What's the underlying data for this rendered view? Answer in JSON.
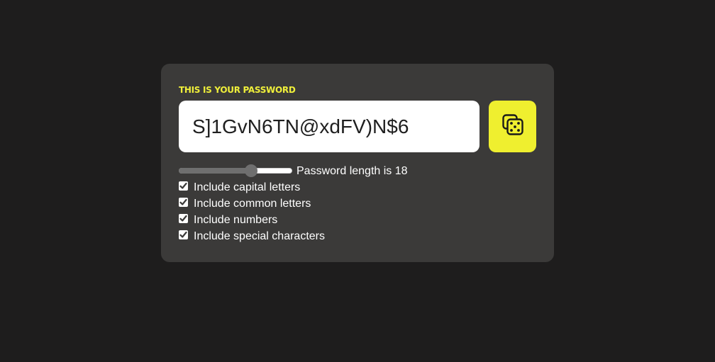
{
  "header": {
    "title": "THIS IS YOUR PASSWORD"
  },
  "password": {
    "value": "S]1GvN6TN@xdFV)N$6"
  },
  "generate_button": {
    "icon": "dice-icon",
    "color": "#efef2f"
  },
  "length": {
    "label": "Password length is 18",
    "value": 18,
    "fraction": 0.64
  },
  "options": [
    {
      "label": "Include capital letters",
      "checked": true
    },
    {
      "label": "Include common letters",
      "checked": true
    },
    {
      "label": "Include numbers",
      "checked": true
    },
    {
      "label": "Include special characters",
      "checked": true
    }
  ],
  "colors": {
    "background": "#1e1d1d",
    "card": "#3b3a39",
    "accent": "#efef3a"
  }
}
